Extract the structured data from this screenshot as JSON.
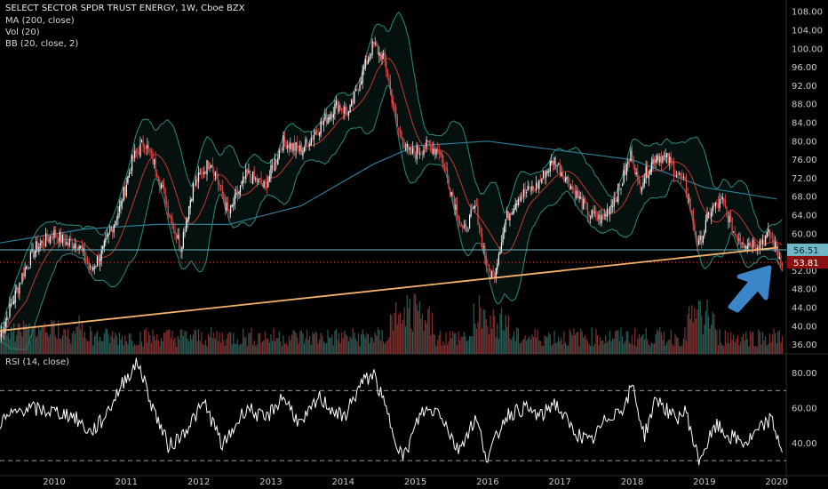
{
  "header": {
    "title": "SELECT SECTOR SPDR TRUST ENERGY, 1W, Cboe BZX",
    "indicators": [
      "MA (200, close)",
      "Vol (20)",
      "BB (20, close, 2)"
    ]
  },
  "rsi_header": "RSI (14, close)",
  "colors": {
    "background": "#000000",
    "up": "#4fb8a8",
    "down": "#e84c4c",
    "bb_band": "#2b8a7e",
    "bb_basis": "#c0392b",
    "ma200": "#2e7d96",
    "trendline": "#f5b26b",
    "hline": "#6fb7c6",
    "vol_up": "#2f6e66",
    "vol_down": "#9c3535",
    "rsi": "#ffffff",
    "axis_text": "#c8c8c8",
    "arrow": "#3a86c8"
  },
  "chart_data": [
    {
      "type": "candlestick",
      "title": "SELECT SECTOR SPDR TRUST ENERGY, 1W, Cboe BZX",
      "x_range": [
        "2009-04",
        "2020-02"
      ],
      "ylim": [
        34,
        109
      ],
      "y_ticks": [
        "108.00",
        "104.00",
        "100.00",
        "96.00",
        "92.00",
        "88.00",
        "84.00",
        "80.00",
        "76.00",
        "72.00",
        "68.00",
        "64.00",
        "60.00",
        "56.00",
        "52.00",
        "48.00",
        "44.00",
        "40.00",
        "36.00"
      ],
      "x_ticks": [
        "2010",
        "2011",
        "2012",
        "2013",
        "2014",
        "2015",
        "2016",
        "2017",
        "2018",
        "2019",
        "2020"
      ],
      "price_labels": [
        {
          "value": "56.51",
          "level": 56.51,
          "color": "#6fb7c6"
        },
        {
          "value": "53.81",
          "level": 53.81,
          "color": "#8b0f0f"
        }
      ],
      "close_path": [
        {
          "x": "2009-04",
          "y": 38
        },
        {
          "x": "2009-06",
          "y": 45
        },
        {
          "x": "2009-08",
          "y": 52
        },
        {
          "x": "2009-10",
          "y": 57
        },
        {
          "x": "2010-01",
          "y": 60
        },
        {
          "x": "2010-03",
          "y": 58
        },
        {
          "x": "2010-05",
          "y": 58
        },
        {
          "x": "2010-07",
          "y": 52
        },
        {
          "x": "2010-09",
          "y": 56
        },
        {
          "x": "2010-12",
          "y": 66
        },
        {
          "x": "2011-02",
          "y": 76
        },
        {
          "x": "2011-04",
          "y": 80
        },
        {
          "x": "2011-06",
          "y": 74
        },
        {
          "x": "2011-08",
          "y": 65
        },
        {
          "x": "2011-10",
          "y": 57
        },
        {
          "x": "2011-12",
          "y": 70
        },
        {
          "x": "2012-03",
          "y": 76
        },
        {
          "x": "2012-06",
          "y": 64
        },
        {
          "x": "2012-09",
          "y": 73
        },
        {
          "x": "2012-12",
          "y": 70
        },
        {
          "x": "2013-03",
          "y": 80
        },
        {
          "x": "2013-06",
          "y": 78
        },
        {
          "x": "2013-09",
          "y": 83
        },
        {
          "x": "2013-12",
          "y": 88
        },
        {
          "x": "2014-02",
          "y": 86
        },
        {
          "x": "2014-04",
          "y": 94
        },
        {
          "x": "2014-06",
          "y": 101
        },
        {
          "x": "2014-08",
          "y": 97
        },
        {
          "x": "2014-10",
          "y": 83
        },
        {
          "x": "2014-12",
          "y": 77
        },
        {
          "x": "2015-03",
          "y": 79
        },
        {
          "x": "2015-05",
          "y": 78
        },
        {
          "x": "2015-07",
          "y": 69
        },
        {
          "x": "2015-09",
          "y": 60
        },
        {
          "x": "2015-11",
          "y": 66
        },
        {
          "x": "2016-01",
          "y": 52
        },
        {
          "x": "2016-02",
          "y": 51
        },
        {
          "x": "2016-04",
          "y": 63
        },
        {
          "x": "2016-06",
          "y": 68
        },
        {
          "x": "2016-09",
          "y": 70
        },
        {
          "x": "2016-12",
          "y": 76
        },
        {
          "x": "2017-03",
          "y": 70
        },
        {
          "x": "2017-06",
          "y": 64
        },
        {
          "x": "2017-08",
          "y": 63
        },
        {
          "x": "2017-11",
          "y": 70
        },
        {
          "x": "2018-01",
          "y": 78
        },
        {
          "x": "2018-02",
          "y": 70
        },
        {
          "x": "2018-05",
          "y": 77
        },
        {
          "x": "2018-07",
          "y": 76
        },
        {
          "x": "2018-10",
          "y": 70
        },
        {
          "x": "2018-12",
          "y": 57
        },
        {
          "x": "2019-02",
          "y": 65
        },
        {
          "x": "2019-04",
          "y": 67
        },
        {
          "x": "2019-06",
          "y": 60
        },
        {
          "x": "2019-08",
          "y": 58
        },
        {
          "x": "2019-10",
          "y": 58
        },
        {
          "x": "2019-12",
          "y": 60
        },
        {
          "x": "2020-01",
          "y": 56
        },
        {
          "x": "2020-02",
          "y": 53.81
        }
      ],
      "ma200": [
        {
          "x": "2009-04",
          "y": 58
        },
        {
          "x": "2010-06",
          "y": 61
        },
        {
          "x": "2011-06",
          "y": 62
        },
        {
          "x": "2012-06",
          "y": 62
        },
        {
          "x": "2013-06",
          "y": 66
        },
        {
          "x": "2014-06",
          "y": 75
        },
        {
          "x": "2015-01",
          "y": 79
        },
        {
          "x": "2016-01",
          "y": 80
        },
        {
          "x": "2017-01",
          "y": 78
        },
        {
          "x": "2018-01",
          "y": 76
        },
        {
          "x": "2019-01",
          "y": 70
        },
        {
          "x": "2020-01",
          "y": 67.5
        }
      ],
      "trendline": {
        "from": {
          "x": "2009-04",
          "y": 39
        },
        "to": {
          "x": "2020-02",
          "y": 57
        }
      },
      "horizontal_line": {
        "y": 56.51
      },
      "dotted_line": {
        "y": 53.81
      }
    },
    {
      "type": "line",
      "title": "RSI (14, close)",
      "ylim": [
        24,
        90
      ],
      "y_ticks": [
        "80.00",
        "60.00",
        "40.00"
      ],
      "bands": [
        70,
        30
      ],
      "series": [
        {
          "points": [
            {
              "x": "2009-04",
              "y": 52
            },
            {
              "x": "2009-08",
              "y": 60
            },
            {
              "x": "2010-01",
              "y": 58
            },
            {
              "x": "2010-04",
              "y": 56
            },
            {
              "x": "2010-07",
              "y": 46
            },
            {
              "x": "2010-09",
              "y": 53
            },
            {
              "x": "2011-01",
              "y": 78
            },
            {
              "x": "2011-03",
              "y": 86
            },
            {
              "x": "2011-05",
              "y": 64
            },
            {
              "x": "2011-08",
              "y": 38
            },
            {
              "x": "2011-10",
              "y": 44
            },
            {
              "x": "2012-02",
              "y": 63
            },
            {
              "x": "2012-05",
              "y": 38
            },
            {
              "x": "2012-09",
              "y": 61
            },
            {
              "x": "2012-12",
              "y": 53
            },
            {
              "x": "2013-03",
              "y": 67
            },
            {
              "x": "2013-06",
              "y": 50
            },
            {
              "x": "2013-09",
              "y": 66
            },
            {
              "x": "2014-01",
              "y": 54
            },
            {
              "x": "2014-04",
              "y": 74
            },
            {
              "x": "2014-06",
              "y": 80
            },
            {
              "x": "2014-09",
              "y": 50
            },
            {
              "x": "2014-11",
              "y": 31
            },
            {
              "x": "2015-02",
              "y": 58
            },
            {
              "x": "2015-05",
              "y": 59
            },
            {
              "x": "2015-08",
              "y": 36
            },
            {
              "x": "2015-11",
              "y": 54
            },
            {
              "x": "2016-01",
              "y": 31
            },
            {
              "x": "2016-04",
              "y": 56
            },
            {
              "x": "2016-07",
              "y": 60
            },
            {
              "x": "2016-10",
              "y": 55
            },
            {
              "x": "2016-12",
              "y": 64
            },
            {
              "x": "2017-03",
              "y": 48
            },
            {
              "x": "2017-06",
              "y": 40
            },
            {
              "x": "2017-09",
              "y": 55
            },
            {
              "x": "2017-12",
              "y": 62
            },
            {
              "x": "2018-01",
              "y": 74
            },
            {
              "x": "2018-03",
              "y": 44
            },
            {
              "x": "2018-05",
              "y": 66
            },
            {
              "x": "2018-08",
              "y": 54
            },
            {
              "x": "2018-10",
              "y": 58
            },
            {
              "x": "2018-12",
              "y": 30
            },
            {
              "x": "2019-03",
              "y": 50
            },
            {
              "x": "2019-05",
              "y": 44
            },
            {
              "x": "2019-08",
              "y": 40
            },
            {
              "x": "2019-10",
              "y": 47
            },
            {
              "x": "2019-12",
              "y": 54
            },
            {
              "x": "2020-02",
              "y": 36
            }
          ]
        }
      ]
    }
  ]
}
